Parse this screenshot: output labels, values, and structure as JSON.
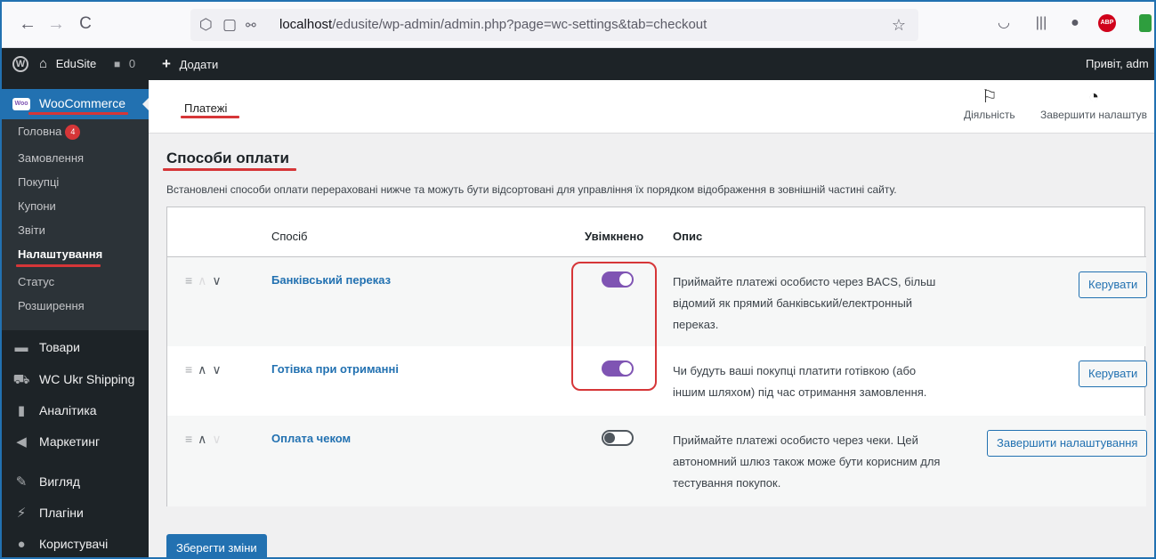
{
  "browser": {
    "back_icon": "←",
    "forward_icon": "→",
    "reload_icon": "C",
    "url_host": "localhost",
    "url_path": "/edusite/wp-admin/admin.php?page=wc-settings&tab=checkout"
  },
  "adminbar": {
    "site_name": "EduSite",
    "comments_count": "0",
    "add_new": "Додати",
    "greeting": "Привіт, adm"
  },
  "sidebar": {
    "woocommerce_label": "WooCommerce",
    "woo_logo_text": "Woo",
    "submenu": [
      {
        "label": "Головна",
        "badge": "4"
      },
      {
        "label": "Замовлення"
      },
      {
        "label": "Покупці"
      },
      {
        "label": "Купони"
      },
      {
        "label": "Звіти"
      },
      {
        "label": "Налаштування"
      },
      {
        "label": "Статус"
      },
      {
        "label": "Розширення"
      }
    ],
    "menu": [
      {
        "label": "Товари",
        "icon": "products-icon"
      },
      {
        "label": "WC Ukr Shipping",
        "icon": "truck-icon"
      },
      {
        "label": "Аналітика",
        "icon": "analytics-icon"
      },
      {
        "label": "Маркетинг",
        "icon": "megaphone-icon"
      },
      {
        "label": "Вигляд",
        "icon": "paintbrush-icon"
      },
      {
        "label": "Плагіни",
        "icon": "plugin-icon"
      },
      {
        "label": "Користувачі",
        "icon": "users-icon"
      }
    ]
  },
  "header": {
    "title": "Платежі",
    "activity_label": "Діяльність",
    "setup_label": "Завершити налаштув"
  },
  "main": {
    "section_title": "Способи оплати",
    "description": "Встановлені способи оплати перераховані нижче та можуть бути відсортовані для управління їх порядком відображення в зовнішній частині сайту.",
    "columns": {
      "method": "Спосіб",
      "enabled": "Увімкнено",
      "description": "Опис"
    },
    "gateways": [
      {
        "name": "Банківський переказ",
        "enabled": true,
        "description": "Приймайте платежі особисто через BACS, більш відомий як прямий банківський/електронный переказ.",
        "action": "Керувати"
      },
      {
        "name": "Готівка при отриманні",
        "enabled": true,
        "description": "Чи будуть ваші покупці платити готівкою (або іншим шляхом) під час отримання замовлення.",
        "action": "Керувати"
      },
      {
        "name": "Оплата чеком",
        "enabled": false,
        "description": "Приймайте платежі особисто через чеки. Цей автономний шлюз також може бути корисним для тестування покупок.",
        "action": "Завершити налаштування"
      }
    ],
    "save_label": "Зберегти зміни"
  },
  "colors": {
    "accent": "#2271b1",
    "toggle_on": "#7f54b3",
    "annotation": "#d63638",
    "admin_dark": "#1d2327"
  }
}
